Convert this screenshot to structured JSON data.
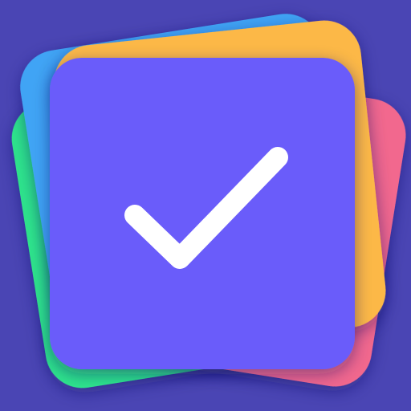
{
  "icon": {
    "semantic": "stacked-cards-checkmark-app-icon",
    "glyph": "check-icon"
  },
  "colors": {
    "background": "#4A45B4",
    "card_green": "#2EE48C",
    "card_pink": "#F2678E",
    "card_blue": "#3FA4F5",
    "card_yellow": "#FCB846",
    "card_front": "#6A5CFA",
    "checkmark": "#FFFFFF"
  }
}
